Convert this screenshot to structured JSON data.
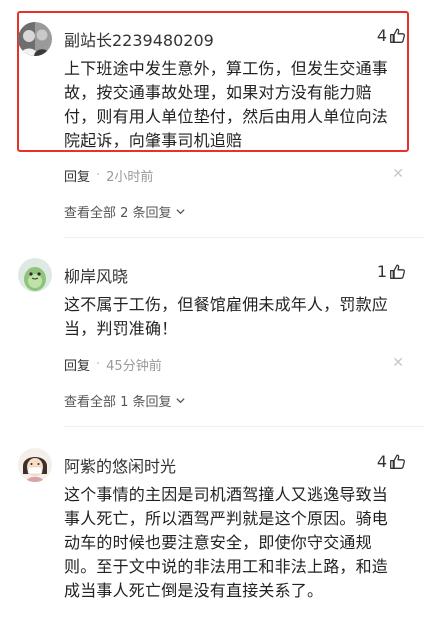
{
  "comments": [
    {
      "author": "副站长2239480209",
      "likes": "4",
      "text": "上下班途中发生意外，算工伤，但发生交通事故，按交通事故处理，如果对方没有能力赔付，则有用人单位垫付，然后由用人单位向法院起诉，向肇事司机追赔",
      "reply_label": "回复",
      "separator": "·",
      "time": "2小时前",
      "close_glyph": "✕",
      "view_all": "查看全部 2 条回复"
    },
    {
      "author": "柳岸风晓",
      "likes": "1",
      "text": "这不属于工伤，但餐馆雇佣未成年人，罚款应当，判罚准确！",
      "reply_label": "回复",
      "separator": "·",
      "time": "45分钟前",
      "close_glyph": "✕",
      "view_all": "查看全部 1 条回复"
    },
    {
      "author": "阿紫的悠闲时光",
      "likes": "4",
      "text": "这个事情的主因是司机酒驾撞人又逃逸导致当事人死亡，所以酒驾严判就是这个原因。骑电动车的时候也要注意安全，即使你守交通规则。至于文中说的非法用工和非法上路，和造成当事人死亡倒是没有直接关系了。"
    }
  ],
  "icons": {
    "like": "thumbs-up-icon",
    "chevron": "chevron-down-icon",
    "close": "close-icon"
  },
  "colors": {
    "highlight": "#e8312a",
    "meta": "#999999",
    "text": "#222222"
  }
}
